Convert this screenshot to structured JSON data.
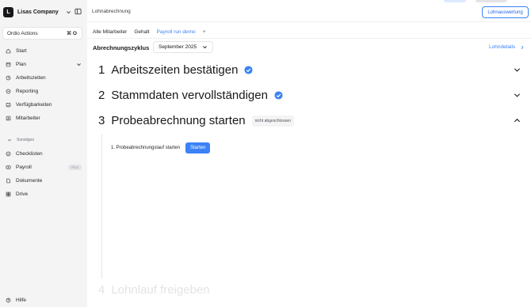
{
  "sidebar": {
    "company_initial": "L",
    "company_name": "Lisas Company",
    "actions_label": "Ordio Actions",
    "actions_shortcut": "⌘ O",
    "items": [
      {
        "label": "Start",
        "icon": "home-icon"
      },
      {
        "label": "Plan",
        "icon": "calendar-icon"
      },
      {
        "label": "Arbeitszeiten",
        "icon": "clock-icon"
      },
      {
        "label": "Reporting",
        "icon": "reporting-icon"
      },
      {
        "label": "Verfügbarkeiten",
        "icon": "calendar-check-icon"
      },
      {
        "label": "Mitarbeiter",
        "icon": "person-icon"
      }
    ],
    "group_label": "Sonstiges",
    "group_items": [
      {
        "label": "Checklisten",
        "icon": "checklist-icon"
      },
      {
        "label": "Payroll",
        "icon": "payroll-icon",
        "badge": "Plus"
      },
      {
        "label": "Dokumente",
        "icon": "document-icon"
      },
      {
        "label": "Drive",
        "icon": "drive-icon"
      }
    ],
    "help_label": "Hilfe"
  },
  "header": {
    "breadcrumb": "Lohnabrechnung",
    "action_button": "Lohnauswertung"
  },
  "tabs": [
    {
      "label": "Alle Mitarbeiter",
      "active": false
    },
    {
      "label": "Gehalt",
      "active": false
    },
    {
      "label": "Payroll run demo",
      "active": true
    }
  ],
  "tab_add": "+",
  "cycle": {
    "label": "Abrechnungszyklus",
    "value": "September 2025",
    "details_link": "Lohndetails"
  },
  "steps": [
    {
      "number": "1",
      "title": "Arbeitszeiten bestätigen",
      "status": "completed"
    },
    {
      "number": "2",
      "title": "Stammdaten vervollständigen",
      "status": "completed"
    },
    {
      "number": "3",
      "title": "Probeabrechnung starten",
      "badge": "nicht abgeschlossen",
      "expanded": true
    },
    {
      "number": "4",
      "title": "Lohnlauf freigeben",
      "status": "disabled"
    }
  ],
  "substep": {
    "label": "1. Probeabrechnungslauf starten",
    "button": "Starten"
  },
  "colors": {
    "accent": "#3b82f6",
    "sidebar_bg": "#f4f4f5"
  }
}
